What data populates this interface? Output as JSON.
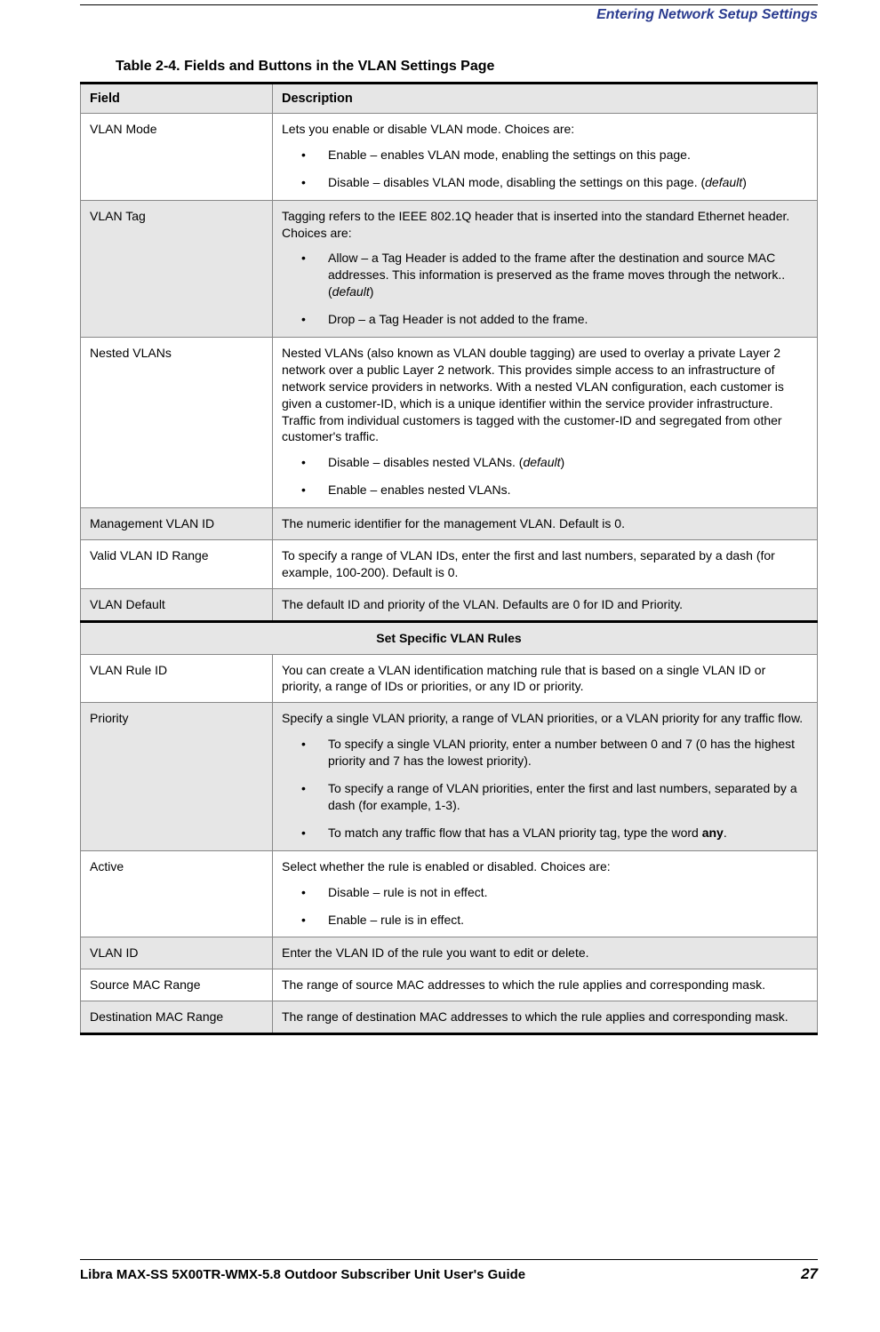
{
  "header": {
    "title": "Entering Network Setup Settings"
  },
  "caption": "Table 2-4. Fields and Buttons in the VLAN Settings Page",
  "columns": {
    "field": "Field",
    "description": "Description"
  },
  "rows": {
    "vlanMode": {
      "field": "VLAN Mode",
      "intro": "Lets you enable or disable VLAN mode. Choices are:",
      "b1": "Enable – enables VLAN mode, enabling the settings on this page.",
      "b2a": "Disable – disables VLAN mode, disabling the settings on this page. (",
      "b2b": "default",
      "b2c": ")"
    },
    "vlanTag": {
      "field": "VLAN Tag",
      "intro": "Tagging refers to the IEEE 802.1Q header that is inserted into the standard Ethernet header. Choices are:",
      "b1a": "Allow – a Tag Header is added to the frame after the destination and source MAC addresses. This information is preserved as the frame moves through the network.. (",
      "b1b": "default",
      "b1c": ")",
      "b2": "Drop – a Tag Header is not added to the frame."
    },
    "nestedVlans": {
      "field": "Nested VLANs",
      "intro": "Nested VLANs (also known as VLAN double tagging) are used to overlay a private Layer 2 network over a public Layer 2 network. This provides simple access to an infrastructure of network service providers in networks. With a nested VLAN configuration, each customer is given a customer-ID, which is a unique identifier within the service provider infrastructure. Traffic from individual customers is tagged with the customer-ID and segregated from other customer's traffic.",
      "b1a": "Disable – disables nested VLANs. (",
      "b1b": "default",
      "b1c": ")",
      "b2": "Enable – enables nested VLANs."
    },
    "mgmtVlanId": {
      "field": "Management VLAN ID",
      "desc": "The numeric identifier for the management VLAN. Default is 0."
    },
    "validRange": {
      "field": "Valid VLAN ID Range",
      "desc": "To specify a range of VLAN IDs, enter the first and last numbers, separated by a dash (for example, 100-200). Default is 0."
    },
    "vlanDefault": {
      "field": "VLAN Default",
      "desc": "The default ID and priority of the VLAN. Defaults are 0 for ID and Priority."
    },
    "section": "Set Specific VLAN Rules",
    "ruleId": {
      "field": "VLAN Rule ID",
      "desc": "You can create a VLAN identification matching rule that is based on a single VLAN ID or priority, a range of IDs or priorities, or any ID or priority."
    },
    "priority": {
      "field": "Priority",
      "intro": "Specify a single VLAN priority, a range of VLAN priorities, or a VLAN priority for any traffic flow.",
      "b1": "To specify a single VLAN priority, enter a number between 0 and 7 (0 has the highest priority and 7 has the lowest priority).",
      "b2": "To specify a range of VLAN priorities, enter the first and last numbers, separated by a dash (for example, 1-3).",
      "b3a": "To match any traffic flow that has a VLAN priority tag, type the word ",
      "b3b": "any",
      "b3c": "."
    },
    "active": {
      "field": "Active",
      "intro": "Select whether the rule is enabled or disabled. Choices are:",
      "b1": "Disable – rule is not in effect.",
      "b2": "Enable – rule is in effect."
    },
    "vlanId": {
      "field": "VLAN ID",
      "desc": "Enter the VLAN ID of the rule you want to edit or delete."
    },
    "srcMac": {
      "field": "Source MAC Range",
      "desc": "The range of source MAC addresses to which the rule applies and corresponding mask."
    },
    "dstMac": {
      "field": "Destination MAC Range",
      "desc": "The range of destination MAC addresses to which the rule applies and corresponding mask."
    }
  },
  "footer": {
    "left": "Libra MAX-SS  5X00TR-WMX-5.8 Outdoor Subscriber Unit User's Guide",
    "page": "27"
  }
}
